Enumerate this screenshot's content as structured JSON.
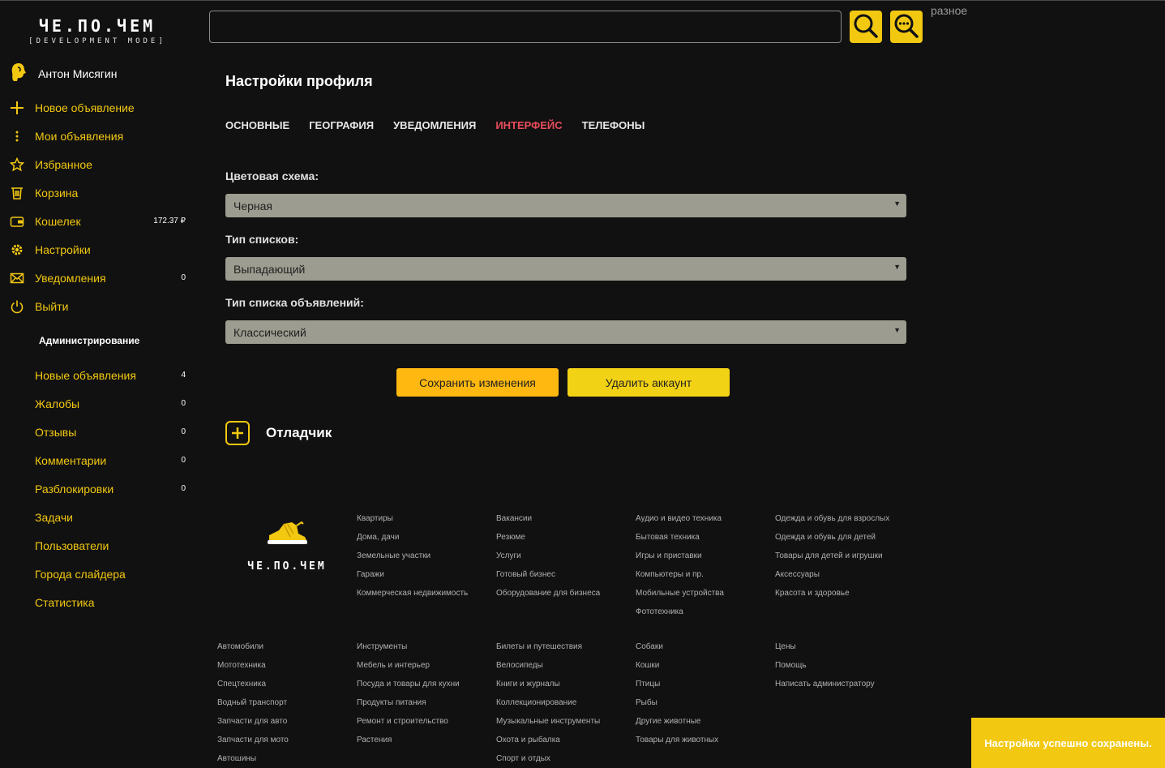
{
  "app": {
    "logo_title": "ЧЕ.ПО.ЧЕМ",
    "logo_subtitle": "[DEVELOPMENT MODE]"
  },
  "search": {
    "placeholder": "",
    "misc_link": "разное"
  },
  "sidebar": {
    "user_name": "Антон Мисягин",
    "items": [
      {
        "label": "Новое объявление",
        "icon": "plus-icon",
        "count": ""
      },
      {
        "label": "Мои объявления",
        "icon": "dots-vertical-icon",
        "count": ""
      },
      {
        "label": "Избранное",
        "icon": "star-icon",
        "count": ""
      },
      {
        "label": "Корзина",
        "icon": "trash-icon",
        "count": ""
      },
      {
        "label": "Кошелек",
        "icon": "wallet-icon",
        "count": "172.37 ₽"
      },
      {
        "label": "Настройки",
        "icon": "gear-icon",
        "count": ""
      },
      {
        "label": "Уведомления",
        "icon": "mail-icon",
        "count": "0"
      },
      {
        "label": "Выйти",
        "icon": "power-icon",
        "count": ""
      }
    ],
    "admin_heading": "Администрирование",
    "admin_items": [
      {
        "label": "Новые объявления",
        "count": "4"
      },
      {
        "label": "Жалобы",
        "count": "0"
      },
      {
        "label": "Отзывы",
        "count": "0"
      },
      {
        "label": "Комментарии",
        "count": "0"
      },
      {
        "label": "Разблокировки",
        "count": "0"
      },
      {
        "label": "Задачи",
        "count": ""
      },
      {
        "label": "Пользователи",
        "count": ""
      },
      {
        "label": "Города слайдера",
        "count": ""
      },
      {
        "label": "Статистика",
        "count": ""
      }
    ]
  },
  "main": {
    "title": "Настройки профиля",
    "tabs": [
      {
        "label": "ОСНОВНЫЕ",
        "active": false
      },
      {
        "label": "ГЕОГРАФИЯ",
        "active": false
      },
      {
        "label": "УВЕДОМЛЕНИЯ",
        "active": false
      },
      {
        "label": "ИНТЕРФЕЙС",
        "active": true
      },
      {
        "label": "ТЕЛЕФОНЫ",
        "active": false
      }
    ],
    "fields": [
      {
        "label": "Цветовая схема:",
        "value": "Черная"
      },
      {
        "label": "Тип списков:",
        "value": "Выпадающий"
      },
      {
        "label": "Тип списка объявлений:",
        "value": "Классический"
      }
    ],
    "save_label": "Сохранить изменения",
    "delete_label": "Удалить аккаунт",
    "debugger_label": "Отладчик"
  },
  "footer": {
    "logo_text": "ЧЕ.ПО.ЧЕМ",
    "top_columns": [
      [
        "Квартиры",
        "Дома, дачи",
        "Земельные участки",
        "Гаражи",
        "Коммерческая недвижимость"
      ],
      [
        "Вакансии",
        "Резюме",
        "Услуги",
        "Готовый бизнес",
        "Оборудование для бизнеса"
      ],
      [
        "Аудио и видео техника",
        "Бытовая техника",
        "Игры и приставки",
        "Компьютеры и пр.",
        "Мобильные устройства",
        "Фототехника"
      ],
      [
        "Одежда и обувь для взрослых",
        "Одежда и обувь для детей",
        "Товары для детей и игрушки",
        "Аксессуары",
        "Красота и здоровье"
      ]
    ],
    "bottom_columns": [
      [
        "Автомобили",
        "Мототехника",
        "Спецтехника",
        "Водный транспорт",
        "Запчасти для авто",
        "Запчасти для мото",
        "Автошины"
      ],
      [
        "Инструменты",
        "Мебель и интерьер",
        "Посуда и товары для кухни",
        "Продукты питания",
        "Ремонт и строительство",
        "Растения"
      ],
      [
        "Билеты и путешествия",
        "Велосипеды",
        "Книги и журналы",
        "Коллекционирование",
        "Музыкальные инструменты",
        "Охота и рыбалка",
        "Спорт и отдых"
      ],
      [
        "Собаки",
        "Кошки",
        "Птицы",
        "Рыбы",
        "Другие животные",
        "Товары для животных"
      ],
      [
        "Цены",
        "Помощь",
        "Написать администратору"
      ]
    ]
  },
  "toast": {
    "message": "Настройки успешно сохранены."
  },
  "colors": {
    "accent": "#f2c811",
    "active_tab": "#e84d5b",
    "background": "#111111",
    "select_bg": "#9d9c90"
  }
}
